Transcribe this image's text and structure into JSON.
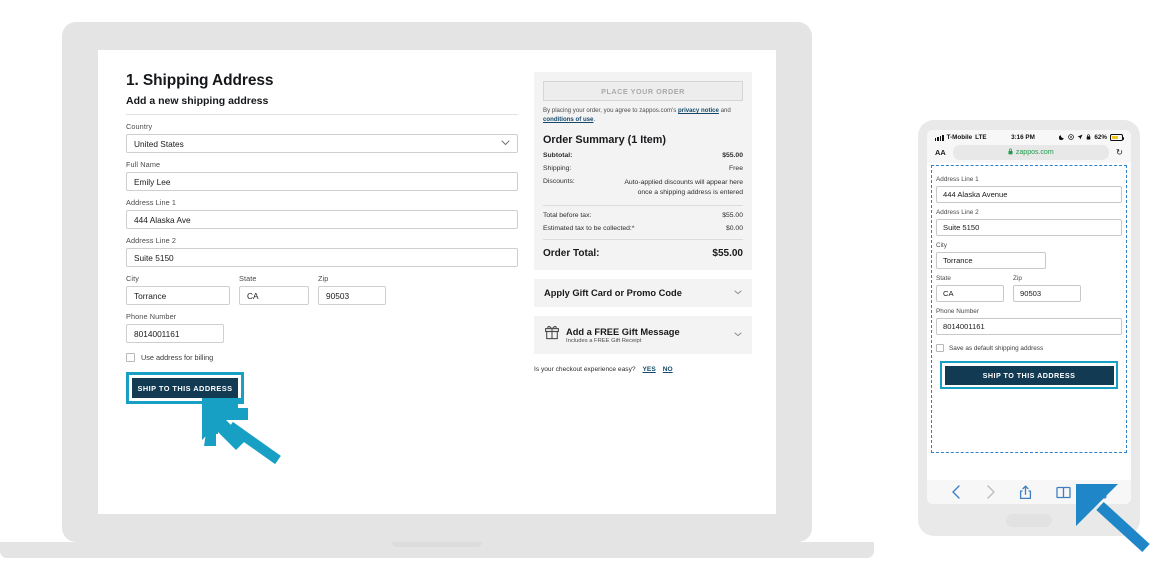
{
  "laptop": {
    "form": {
      "heading": "1. Shipping Address",
      "subheading": "Add a new shipping address",
      "fields": [
        {
          "label": "Country",
          "value": "United States",
          "type": "select"
        },
        {
          "label": "Full Name",
          "value": "Emily Lee",
          "type": "text"
        },
        {
          "label": "Address Line 1",
          "value": "444 Alaska Ave",
          "type": "text"
        },
        {
          "label": "Address Line 2",
          "value": "Suite 5150",
          "type": "text"
        },
        {
          "label": "City",
          "value": "Torrance",
          "type": "text"
        },
        {
          "label": "State",
          "value": "CA",
          "type": "text"
        },
        {
          "label": "Zip",
          "value": "90503",
          "type": "text"
        },
        {
          "label": "Phone Number",
          "value": "8014001161",
          "type": "text"
        }
      ],
      "checkbox_label": "Use address for billing",
      "submit_label": "SHIP TO THIS ADDRESS"
    },
    "summary": {
      "place_order_label": "PLACE YOUR ORDER",
      "legal_prefix": "By placing your order, you agree to zappos.com's ",
      "legal_link1": "privacy notice",
      "legal_mid": " and ",
      "legal_link2": "conditions of use",
      "legal_suffix": ".",
      "title": "Order Summary (1 Item)",
      "lines": [
        {
          "label": "Subtotal:",
          "value": "$55.00",
          "bold": true
        },
        {
          "label": "Shipping:",
          "value": "Free",
          "bold": false
        },
        {
          "label": "Discounts:",
          "value": "Auto-applied discounts will appear here once a shipping address is entered",
          "bold": false
        },
        {
          "label": "Total before tax:",
          "value": "$55.00",
          "bold": false
        },
        {
          "label": "Estimated tax to be collected:*",
          "value": "$0.00",
          "bold": false
        }
      ],
      "total_label": "Order Total:",
      "total_value": "$55.00",
      "promo_label": "Apply Gift Card or Promo Code",
      "gift_title": "Add a FREE Gift Message",
      "gift_sub": "Includes a FREE Gift Receipt",
      "feedback_question": "Is your checkout experience easy?",
      "feedback_yes": "YES",
      "feedback_no": "NO"
    }
  },
  "phone": {
    "status": {
      "carrier": "T-Mobile",
      "network": "LTE",
      "time": "3:16 PM",
      "battery": "62%"
    },
    "browser": {
      "text_size_label": "AA",
      "domain": "zappos.com",
      "reload_label": "↻"
    },
    "form": {
      "fields": [
        {
          "label": "Address Line 1",
          "value": "444 Alaska Avenue"
        },
        {
          "label": "Address Line 2",
          "value": "Suite 5150"
        },
        {
          "label": "City",
          "value": "Torrance"
        },
        {
          "label": "State",
          "value": "CA"
        },
        {
          "label": "Zip",
          "value": "90503"
        },
        {
          "label": "Phone Number",
          "value": "8014001161"
        }
      ],
      "checkbox_label": "Save as default shipping address",
      "submit_label": "SHIP TO THIS ADDRESS"
    }
  },
  "colors": {
    "accent_cyan": "#17a0c4",
    "button_navy": "#123a52",
    "link_navy": "#14496b",
    "dashed_blue": "#2f7fc9",
    "battery_yellow": "#f5c518"
  }
}
